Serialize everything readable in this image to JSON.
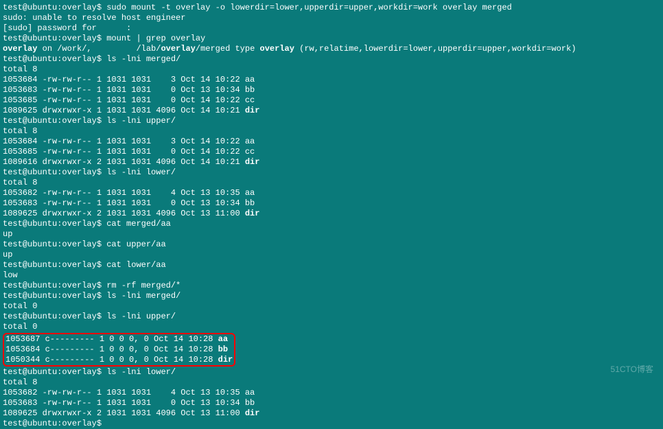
{
  "prompt": "test@ubuntu:overlay$ ",
  "cmd_mount": "sudo mount -t overlay -o lowerdir=lower,upperdir=upper,workdir=work overlay merged",
  "sudo_err": "sudo: unable to resolve host engineer",
  "sudo_pw": "[sudo] password for      :",
  "cmd_mgrep": "mount | grep overlay",
  "mg_1": "overlay",
  "mg_2": " on /work/,         /lab/",
  "mg_3": "overlay",
  "mg_4": "/merged type ",
  "mg_5": "overlay",
  "mg_6": " (rw,relatime,lowerdir=lower,upperdir=upper,workdir=work)",
  "cmd_ls_merged": "ls -lni merged/",
  "total8": "total 8",
  "total0": "total 0",
  "merged_aa": "1053684 -rw-rw-r-- 1 1031 1031    3 Oct 14 10:22 aa",
  "merged_bb": "1053683 -rw-rw-r-- 1 1031 1031    0 Oct 13 10:34 bb",
  "merged_cc": "1053685 -rw-rw-r-- 1 1031 1031    0 Oct 14 10:22 cc",
  "merged_dir_p": "1089625 drwxrwxr-x 1 1031 1031 4096 Oct 14 10:21 ",
  "merged_dir_n": "dir",
  "cmd_ls_upper": "ls -lni upper/",
  "upper_aa": "1053684 -rw-rw-r-- 1 1031 1031    3 Oct 14 10:22 aa",
  "upper_cc": "1053685 -rw-rw-r-- 1 1031 1031    0 Oct 14 10:22 cc",
  "upper_dir_p": "1089616 drwxrwxr-x 2 1031 1031 4096 Oct 14 10:21 ",
  "upper_dir_n": "dir",
  "cmd_ls_lower": "ls -lni lower/",
  "lower_aa": "1053682 -rw-rw-r-- 1 1031 1031    4 Oct 13 10:35 aa",
  "lower_bb": "1053683 -rw-rw-r-- 1 1031 1031    0 Oct 13 10:34 bb",
  "lower_dir_p": "1089625 drwxrwxr-x 2 1031 1031 4096 Oct 13 11:00 ",
  "lower_dir_n": "dir",
  "cmd_cat_merged": "cat merged/aa",
  "out_up": "up",
  "cmd_cat_upper": "cat upper/aa",
  "cmd_cat_lower": "cat lower/aa",
  "out_low": "low",
  "cmd_rm": "rm -rf merged/*",
  "cmd_ls_merged2": "ls -lni merged/",
  "cmd_ls_upper2": "ls -lni upper/",
  "box_aa_p": "1053687 c--------- 1 0 0 0, 0 Oct 14 10:28 ",
  "box_aa_n": "aa",
  "box_bb_p": "1053684 c--------- 1 0 0 0, 0 Oct 14 10:28 ",
  "box_bb_n": "bb",
  "box_dir_p": "1050344 c--------- 1 0 0 0, 0 Oct 14 10:28 ",
  "box_dir_n": "dir",
  "cmd_ls_lower2": "ls -lni lower/",
  "lower2_aa": "1053682 -rw-rw-r-- 1 1031 1031    4 Oct 13 10:35 aa",
  "lower2_bb": "1053683 -rw-rw-r-- 1 1031 1031    0 Oct 13 10:34 bb",
  "lower2_dir_p": "1089625 drwxrwxr-x 2 1031 1031 4096 Oct 13 11:00 ",
  "lower2_dir_n": "dir",
  "watermark": "51CTO博客"
}
